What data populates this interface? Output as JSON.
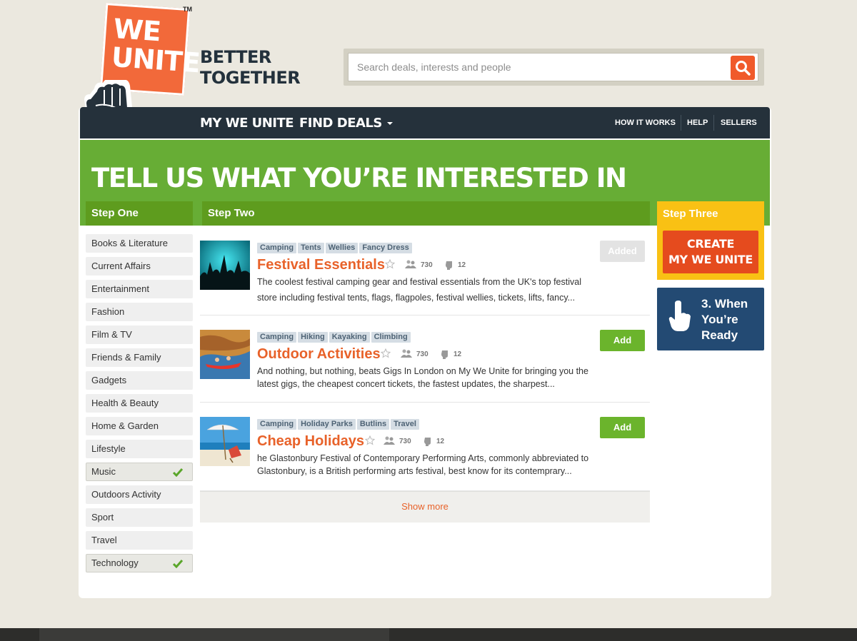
{
  "logo": {
    "line1": "WE",
    "line2": "UNITE",
    "tm": "TM",
    "slogan": "BETTER\nTOGETHER"
  },
  "search": {
    "placeholder": "Search deals, interests and people",
    "icon": "search-icon"
  },
  "nav": {
    "main": [
      "MY WE UNITE",
      "FIND DEALS"
    ],
    "util": [
      "HOW IT WORKS",
      "HELP",
      "SELLERS"
    ]
  },
  "banner": {
    "title": "TELL US WHAT YOU’RE INTERESTED IN"
  },
  "steps": {
    "one": "Step One",
    "two": "Step Two",
    "three": "Step Three"
  },
  "interests": [
    {
      "label": "Books & Literature",
      "selected": false
    },
    {
      "label": "Current Affairs",
      "selected": false
    },
    {
      "label": "Entertainment",
      "selected": false
    },
    {
      "label": "Fashion",
      "selected": false
    },
    {
      "label": "Film & TV",
      "selected": false
    },
    {
      "label": "Friends & Family",
      "selected": false
    },
    {
      "label": "Gadgets",
      "selected": false
    },
    {
      "label": "Health & Beauty",
      "selected": false
    },
    {
      "label": "Home & Garden",
      "selected": false
    },
    {
      "label": "Lifestyle",
      "selected": false
    },
    {
      "label": "Music",
      "selected": true
    },
    {
      "label": "Outdoors Activity",
      "selected": false
    },
    {
      "label": "Sport",
      "selected": false
    },
    {
      "label": "Travel",
      "selected": false
    },
    {
      "label": "Technology",
      "selected": true
    }
  ],
  "deals": [
    {
      "tags": [
        "Camping",
        "Tents",
        "Wellies",
        "Fancy Dress"
      ],
      "title": "Festival Essentials",
      "members": "730",
      "votes": "12",
      "desc": "The coolest festival camping gear and festival essentials from the UK's top festival store including festival tents, flags, flagpoles, festival wellies, tickets, lifts, fancy...",
      "button": "Added"
    },
    {
      "tags": [
        "Camping",
        "Hiking",
        "Kayaking",
        "Climbing"
      ],
      "title": "Outdoor Activities",
      "members": "730",
      "votes": "12",
      "desc": "And nothing, but nothing, beats Gigs In London on My We Unite for bringing you the latest gigs, the cheapest concert tickets, the fastest updates, the sharpest...",
      "button": "Add"
    },
    {
      "tags": [
        "Camping",
        "Holiday Parks",
        "Butlins",
        "Travel"
      ],
      "title": "Cheap Holidays",
      "members": "730",
      "votes": "12",
      "desc": "he Glastonbury Festival of Contemporary Performing Arts, commonly abbreviated to Glastonbury, is a British performing arts festival, best know for its contemprary...",
      "button": "Add"
    }
  ],
  "show_more": "Show more",
  "create_button": "CREATE\nMY WE UNITE",
  "ready_text": "3. When\nYou’re\nReady",
  "colors": {
    "orange": "#e8622a",
    "green": "#67ad35",
    "dark_green": "#5e9c1e",
    "navy": "#25313b",
    "yellow": "#f9c114",
    "blue": "#234a73"
  }
}
